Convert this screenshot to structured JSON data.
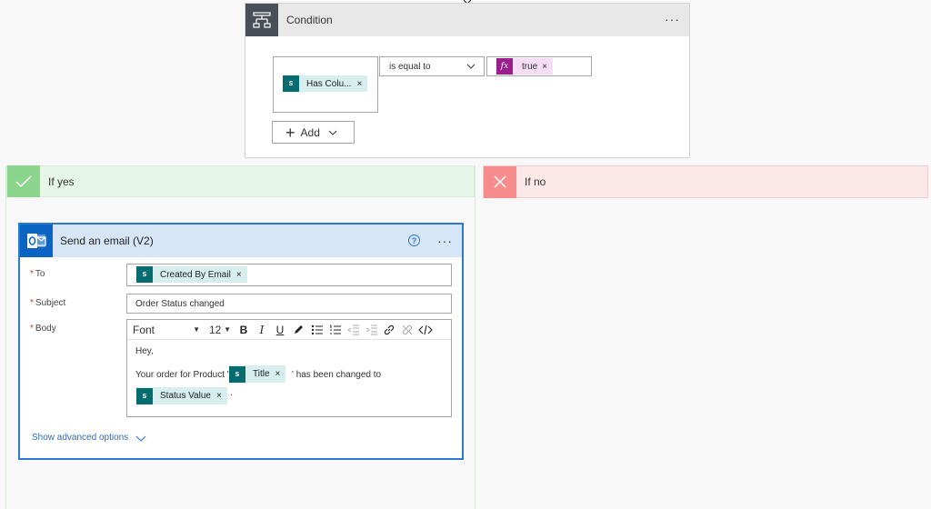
{
  "condition": {
    "title": "Condition",
    "more_label": "···",
    "left_operand": {
      "token_label": "Has Colu...",
      "remove": "×"
    },
    "operator": "is equal to",
    "right_operand": {
      "fx_label": "fx",
      "token_label": "true",
      "remove": "×"
    },
    "add_label": "Add"
  },
  "branches": {
    "yes_label": "If yes",
    "no_label": "If no"
  },
  "email": {
    "title": "Send an email (V2)",
    "help": "?",
    "more_label": "···",
    "required_mark": "*",
    "to_label": "To",
    "to_token": "Created By Email",
    "subject_label": "Subject",
    "subject_value": "Order Status changed",
    "body_label": "Body",
    "toolbar": {
      "font": "Font",
      "size": "12",
      "bold": "B",
      "italic": "I",
      "underline": "U"
    },
    "body_line1": "Hey,",
    "body_line2_prefix": "Your order for Product '",
    "body_title_token": "Title",
    "body_line2_suffix": "' has been changed to",
    "body_status_token": "Status Value",
    "body_line3_suffix": "·",
    "remove": "×",
    "show_advanced": "Show advanced options"
  },
  "colors": {
    "accent": "#2b79d0",
    "sharepoint": "#036c70",
    "fx": "#9b1e8d",
    "yes": "#8bd48b",
    "no": "#f78c8c"
  }
}
